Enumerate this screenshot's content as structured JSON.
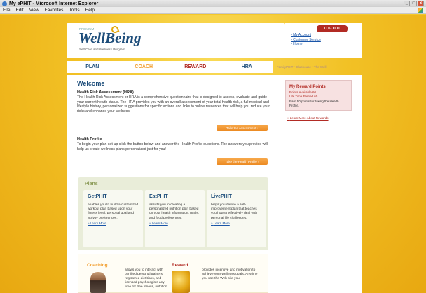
{
  "window": {
    "title": "My ePHIT - Microsoft Internet Explorer",
    "menu": [
      "File",
      "Edit",
      "View",
      "Favorites",
      "Tools",
      "Help"
    ]
  },
  "header": {
    "logo_text": "WellBeing",
    "logo_sub": "Self Care and Wellness Program",
    "logo_small": "PREMIUM",
    "logout": "LOG OUT",
    "account_links": [
      "My Account",
      "Customer Service",
      "Home"
    ]
  },
  "nav": {
    "tabs": [
      {
        "label": "PLAN",
        "color": "#1d4d7a"
      },
      {
        "label": "COACH",
        "color": "#f2a033"
      },
      {
        "label": "REWARD",
        "color": "#b22b24"
      },
      {
        "label": "HRA",
        "color": "#1d4d7a"
      }
    ],
    "links": "• FamilyPHIT   • Clubhouse   • The Well"
  },
  "main": {
    "welcome": "Welcome",
    "hra_title": "Health Risk Assessment (HRA)",
    "hra_text": "The Health Risk Assessment or HRA is a comprehensive questionnaire that is designed to assess, evaluate and guide your current health status. The HRA provides you with an overall assessment of your total health risk, a full medical and lifestyle history, personalized suggestions for specific actions and links to online resources that will help you reduce your risks and enhance your wellness.",
    "hra_button": "Take the Assessment",
    "profile_title": "Health Profile",
    "profile_text": "To begin your plan set-up click the button below and answer the Health Profile questions. The answers you provide will help us create wellness plans personalized just for you!",
    "profile_button": "Take the Health Profile"
  },
  "reward_box": {
    "title": "My Reward Points",
    "available": "Points Available 60",
    "earned": "Life Time Earned 60",
    "earn_text": "Earn 50 points for taking the Health Profile.",
    "learn_more": "Learn More About Rewards"
  },
  "plans": {
    "title": "Plans",
    "items": [
      {
        "name": "GetPHIT",
        "desc": "enables you to build a customized workout plan based upon your fitness level, personal goal and activity preferences.",
        "learn": "Learn More"
      },
      {
        "name": "EatPHIT",
        "desc": "assists you in creating a personalized nutrition plan based on your health information, goals, and food preferences.",
        "learn": "Learn More"
      },
      {
        "name": "LivePHIT",
        "desc": "helps you devise a self-improvement plan that teaches you how to effectively deal with personal life challenges.",
        "learn": "Learn More"
      }
    ]
  },
  "bottom": {
    "coaching_title": "Coaching",
    "coaching_text": "allows you to interact with certified personal trainers, registered dietitians, and licensed psychologists any time for free fitness, nutrition",
    "reward_title": "Reward",
    "reward_text": "provides incentive and motivation to achieve your wellness goals. Anytime you use the Web site you"
  }
}
